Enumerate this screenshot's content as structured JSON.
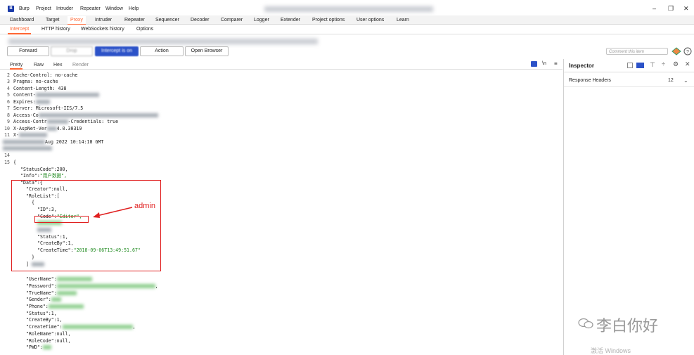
{
  "menu": [
    "Burp",
    "Project",
    "Intruder",
    "Repeater",
    "Window",
    "Help"
  ],
  "tool_tabs": [
    "Dashboard",
    "Target",
    "Proxy",
    "Intruder",
    "Repeater",
    "Sequencer",
    "Decoder",
    "Comparer",
    "Logger",
    "Extender",
    "Project options",
    "User options",
    "Learn"
  ],
  "proxy_tabs": [
    "Intercept",
    "HTTP history",
    "WebSockets history",
    "Options"
  ],
  "toolbar": {
    "forward": "Forward",
    "drop": "Drop",
    "intercept": "Intercept is on",
    "action": "Action",
    "open_browser": "Open Browser",
    "comment_placeholder": "Comment this item"
  },
  "editor_tabs": [
    "Pretty",
    "Raw",
    "Hex",
    "Render"
  ],
  "editor_icons": {
    "wrap": "\\n",
    "menu": "≡"
  },
  "code_lines": {
    "l2": "Cache-Control: no-cache",
    "l3": "Pragma: no-cache",
    "l4": "Content-Length: 438",
    "l5": "Content-",
    "l6": "Expires:",
    "l7": "Server: Microsoft-IIS/7.5",
    "l8": "Access-Co",
    "l9a": "Access-Contr",
    "l9b": "-Credentials: true",
    "l10a": "X-AspNet-Ver",
    "l10b": "4.0.30319",
    "l11": "X-",
    "l12": "Aug 2022 10:14:18 GMT",
    "l15": "{",
    "status_code": "\"StatusCode\":200,",
    "info_key": "\"Info\":",
    "info_val": "\"用户数据\",",
    "data_key": "\"Data\":{",
    "creator": "\"Creator\":null,",
    "rolelist": "\"RoleList\":[",
    "open_brace": "{",
    "id": "\"ID\":3,",
    "code_key": "\"Code\":",
    "code_val": "\"Editor\",",
    "status": "\"Status\":1,",
    "createby": "\"CreateBy\":1,",
    "createtime_key": "\"CreateTime\":",
    "createtime_val": "\"2018-09-06T13:49:51.67\"",
    "close_brace": "}",
    "close_bracket": "]",
    "username": "\"UserName\":",
    "password": "\"Password\":",
    "truename": "\"TrueName\":",
    "gender": "\"Gender\":",
    "phone": "\"Phone\":",
    "status2": "\"Status\":1,",
    "createby2": "\"CreateBy\":1,",
    "createtime2": "\"CreateTime\":",
    "rolename": "\"RoleName\":null,",
    "rolecode": "\"RoleCode\":null,",
    "pwd": "\"PWD\":"
  },
  "annotation": {
    "label": "admin"
  },
  "inspector": {
    "title": "Inspector",
    "response_headers": "Response Headers",
    "count": "12"
  },
  "watermark": {
    "text": "李白你好",
    "activate": "激活 Windows"
  },
  "colors": {
    "accent": "#ff6633",
    "intercept": "#2c52c8",
    "annotation": "#e02020",
    "string": "#1f8a1f"
  }
}
